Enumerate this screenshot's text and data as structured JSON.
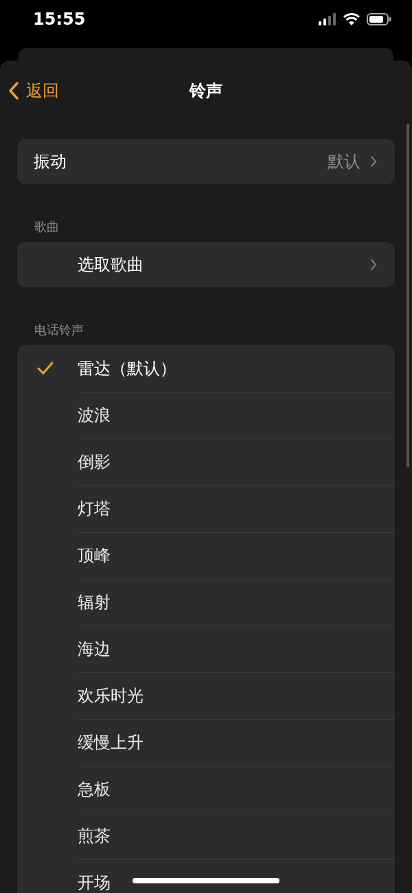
{
  "status_bar": {
    "time": "15:55"
  },
  "nav": {
    "back": "返回",
    "title": "铃声"
  },
  "vibration": {
    "label": "振动",
    "value": "默认"
  },
  "songs": {
    "header": "歌曲",
    "pick": "选取歌曲"
  },
  "ringtones": {
    "header": "电话铃声",
    "items": [
      {
        "label": "雷达（默认）",
        "selected": true
      },
      {
        "label": "波浪",
        "selected": false
      },
      {
        "label": "倒影",
        "selected": false
      },
      {
        "label": "灯塔",
        "selected": false
      },
      {
        "label": "顶峰",
        "selected": false
      },
      {
        "label": "辐射",
        "selected": false
      },
      {
        "label": "海边",
        "selected": false
      },
      {
        "label": "欢乐时光",
        "selected": false
      },
      {
        "label": "缓慢上升",
        "selected": false
      },
      {
        "label": "急板",
        "selected": false
      },
      {
        "label": "煎茶",
        "selected": false
      },
      {
        "label": "开场",
        "selected": false
      }
    ]
  }
}
